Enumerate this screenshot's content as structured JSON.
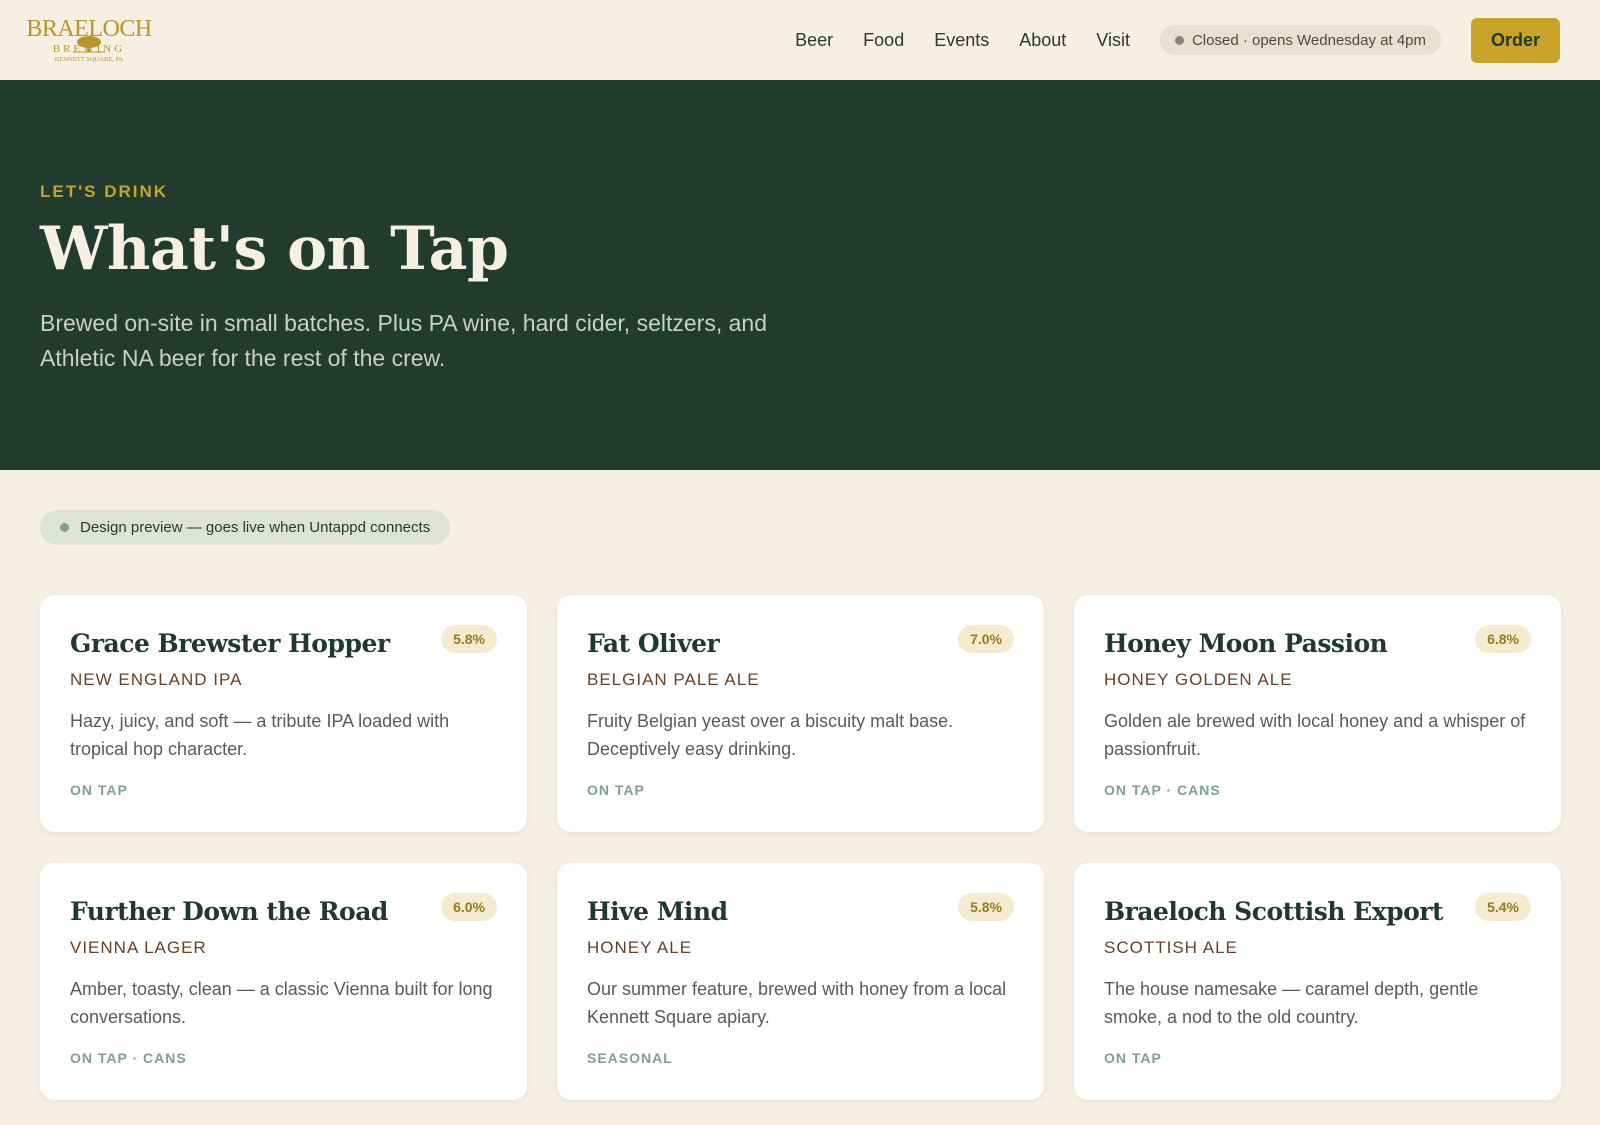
{
  "brand": {
    "logo_word": "BRAELOCH",
    "logo_sub": "BREWING",
    "logo_location": "KENNETT SQUARE, PA"
  },
  "nav": {
    "links": [
      "Beer",
      "Food",
      "Events",
      "About",
      "Visit"
    ],
    "status": "Closed · opens Wednesday at 4pm",
    "order_label": "Order"
  },
  "hero": {
    "eyebrow": "LET'S DRINK",
    "title": "What's on Tap",
    "subtitle": "Brewed on-site in small batches. Plus PA wine, hard cider, seltzers, and Athletic NA beer for the rest of the crew."
  },
  "preview": {
    "label": "Design preview — goes live when Untappd connects"
  },
  "beers": [
    {
      "name": "Grace Brewster Hopper",
      "abv": "5.8%",
      "style": "NEW ENGLAND IPA",
      "description": "Hazy, juicy, and soft — a tribute IPA loaded with tropical hop character.",
      "availability": "ON TAP"
    },
    {
      "name": "Fat Oliver",
      "abv": "7.0%",
      "style": "BELGIAN PALE ALE",
      "description": "Fruity Belgian yeast over a biscuity malt base. Deceptively easy drinking.",
      "availability": "ON TAP"
    },
    {
      "name": "Honey Moon Passion",
      "abv": "6.8%",
      "style": "HONEY GOLDEN ALE",
      "description": "Golden ale brewed with local honey and a whisper of passionfruit.",
      "availability": "ON TAP · CANS"
    },
    {
      "name": "Further Down the Road",
      "abv": "6.0%",
      "style": "VIENNA LAGER",
      "description": "Amber, toasty, clean — a classic Vienna built for long conversations.",
      "availability": "ON TAP · CANS"
    },
    {
      "name": "Hive Mind",
      "abv": "5.8%",
      "style": "HONEY ALE",
      "description": "Our summer feature, brewed with honey from a local Kennett Square apiary.",
      "availability": "SEASONAL"
    },
    {
      "name": "Braeloch Scottish Export",
      "abv": "5.4%",
      "style": "SCOTTISH ALE",
      "description": "The house namesake — caramel depth, gentle smoke, a nod to the old country.",
      "availability": "ON TAP"
    }
  ],
  "colors": {
    "background": "#f6efe3",
    "hero_green": "#213b2e",
    "gold_accent": "#c9a22a",
    "style_brown": "#6b3f22",
    "availability_sage": "#7fa090"
  }
}
